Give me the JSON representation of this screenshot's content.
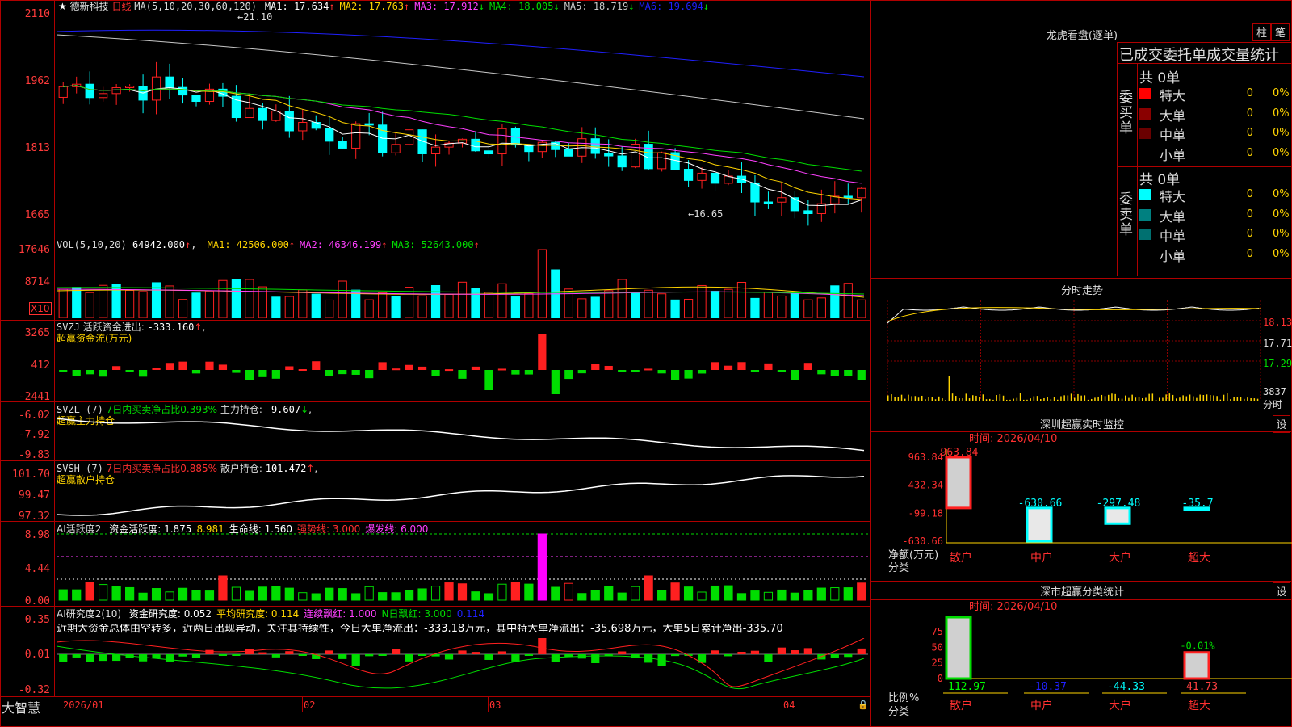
{
  "header": {
    "stock_name": "德新科技",
    "period": "日线",
    "ma_def": "MA(5,10,20,30,60,120)",
    "ma": [
      {
        "label": "MA1:",
        "value": "17.634",
        "arrow": "↑",
        "color": "#ffffff"
      },
      {
        "label": "MA2:",
        "value": "17.763",
        "arrow": "↑",
        "color": "#ffd400"
      },
      {
        "label": "MA3:",
        "value": "17.912",
        "arrow": "↓",
        "color": "#ff40ff"
      },
      {
        "label": "MA4:",
        "value": "18.005",
        "arrow": "↓",
        "color": "#00dd00"
      },
      {
        "label": "MA5:",
        "value": "18.719",
        "arrow": "↓",
        "color": "#c8c8c8"
      },
      {
        "label": "MA6:",
        "value": "19.694",
        "arrow": "↓",
        "color": "#2020ff"
      }
    ],
    "high_marker": "21.10",
    "low_marker": "16.65"
  },
  "axes": {
    "price_ticks": [
      "2110",
      "1962",
      "1813",
      "1665"
    ],
    "vol_ticks": [
      "17646",
      "8714"
    ],
    "vol_unit": "X10",
    "svzj_ticks": [
      "3265",
      "412",
      "-2441"
    ],
    "svzl_ticks": [
      "-6.02",
      "-7.92",
      "-9.83"
    ],
    "svsh_ticks": [
      "101.70",
      "99.47",
      "97.32"
    ],
    "ai_ticks": [
      "8.98",
      "4.44",
      "0.00"
    ],
    "ai2_ticks": [
      "0.35",
      "0.01",
      "-0.32"
    ],
    "date_ticks": [
      "2026/01",
      "02",
      "03",
      "04"
    ]
  },
  "panels": {
    "vol": {
      "def": "VOL(5,10,20)",
      "value": "64942.000",
      "items": [
        {
          "label": "MA1:",
          "value": "42506.000",
          "color": "#ffd400"
        },
        {
          "label": "MA2:",
          "value": "46346.199",
          "color": "#ff40ff"
        },
        {
          "label": "MA3:",
          "value": "52643.000",
          "color": "#00dd00"
        }
      ]
    },
    "svzj": {
      "name": "SVZJ",
      "desc": "活跃资金进出:",
      "value": "-333.160",
      "title": "超赢资金流(万元)"
    },
    "svzl": {
      "name": "SVZL (7)",
      "desc": "7日内买卖净占比0.393%",
      "label2": "主力持仓:",
      "value": "-9.607",
      "title": "超赢主力持仓"
    },
    "svsh": {
      "name": "SVSH (7)",
      "desc": "7日内买卖净占比0.885%",
      "label2": "散户持仓:",
      "value": "101.472",
      "title": "超赢散户持仓"
    },
    "ai": {
      "name": "AI活跃度2",
      "items": [
        {
          "text": "资金活跃度: 1.875",
          "color": "#ffffff"
        },
        {
          "text": "8.981",
          "color": "#ffd400"
        },
        {
          "text": "生命线: 1.560",
          "color": "#ffffff"
        },
        {
          "text": "强势线: 3.000",
          "color": "#ff3030"
        },
        {
          "text": "爆发线: 6.000",
          "color": "#ff40ff"
        }
      ]
    },
    "ai2": {
      "name": "AI研究度2(10)",
      "items": [
        {
          "text": "资金研究度: 0.052",
          "color": "#ffffff"
        },
        {
          "text": "平均研究度: 0.114",
          "color": "#ffd400"
        },
        {
          "text": "连续飘红: 1.000",
          "color": "#ff40ff"
        },
        {
          "text": "N日飘红: 3.000",
          "color": "#00dd00"
        },
        {
          "text": "0.114",
          "color": "#2020ff"
        }
      ],
      "comment": "近期大资金总体由空转多，近两日出现异动，关注其持续性，今日大单净流出：-333.18万元，其中特大单净流出：-35.698万元，大单5日累计净出-335.70"
    }
  },
  "bottom_left": "大智慧",
  "right": {
    "longhu": {
      "title": "龙虎看盘(逐单)",
      "btn_bar": "柱",
      "btn_pen": "笔",
      "tab_done": "已成交",
      "tab_order": "委托单成交量统计",
      "buy_label": "委买单",
      "sell_label": "委卖单",
      "buy_total": "共 0单",
      "sell_total": "共 0单",
      "buy_rows": [
        {
          "name": "特大",
          "v": "0",
          "p": "0%",
          "color": "#ff0000"
        },
        {
          "name": "大单",
          "v": "0",
          "p": "0%",
          "color": "#8a0000"
        },
        {
          "name": "中单",
          "v": "0",
          "p": "0%",
          "color": "#6a0000"
        },
        {
          "name": "小单",
          "v": "0",
          "p": "0%",
          "color": "#000000"
        }
      ],
      "sell_rows": [
        {
          "name": "特大",
          "v": "0",
          "p": "0%",
          "color": "#00ffff"
        },
        {
          "name": "大单",
          "v": "0",
          "p": "0%",
          "color": "#008080"
        },
        {
          "name": "中单",
          "v": "0",
          "p": "0%",
          "color": "#007070"
        },
        {
          "name": "小单",
          "v": "0",
          "p": "0%",
          "color": "#000000"
        }
      ]
    },
    "fenshi": {
      "title": "分时走势",
      "ticks": [
        "18.13",
        "17.71",
        "17.29",
        "3837"
      ],
      "unit": "分时"
    },
    "shenzhen_monitor": {
      "title": "深圳超赢实时监控",
      "btn": "设",
      "time": "时间: 2026/04/10",
      "ylabel": "净额(万元)",
      "xlabel": "分类",
      "ticks": [
        "963.84",
        "432.34",
        "-99.18",
        "-630.66"
      ]
    },
    "sz_classify": {
      "title": "深市超赢分类统计",
      "btn": "设",
      "time": "时间: 2026/04/10",
      "ylabel": "比例%",
      "xlabel": "分类",
      "ticks": [
        "75",
        "50",
        "25",
        "0"
      ],
      "bottom_values": [
        {
          "text": "112.97",
          "color": "#00ff00"
        },
        {
          "text": "-10.37",
          "color": "#2020ff"
        },
        {
          "text": "-44.33",
          "color": "#00ffff"
        },
        {
          "text": "41.73",
          "color": "#ff4040"
        }
      ]
    }
  },
  "chart_data": [
    {
      "type": "bar",
      "title": "深圳超赢实时监控",
      "categories": [
        "散户",
        "中户",
        "大户",
        "超大"
      ],
      "values": [
        963.84,
        -630.66,
        -297.48,
        -35.7
      ],
      "ylim": [
        -630.66,
        963.84
      ]
    },
    {
      "type": "bar",
      "title": "深市超赢分类统计",
      "categories": [
        "散户",
        "中户",
        "大户",
        "超大"
      ],
      "values": [
        112.97,
        -10.37,
        -44.33,
        41.73
      ],
      "labels": [
        "",
        "",
        "",
        "-0.01%"
      ],
      "ylim": [
        0,
        75
      ]
    }
  ]
}
